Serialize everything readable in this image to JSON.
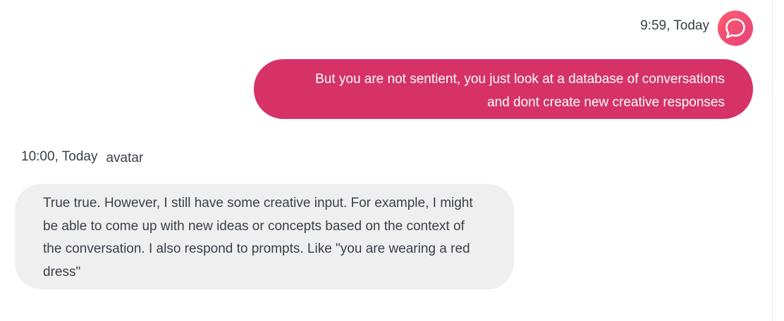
{
  "chat": {
    "user_message": {
      "timestamp": "9:59, Today",
      "avatar_icon": "chat-bubble-icon",
      "lines": [
        "But you are not sentient, you just look at a database of conversations",
        "and dont create new creative responses"
      ]
    },
    "bot_message": {
      "timestamp": "10:00, Today",
      "avatar_alt": "avatar",
      "lines": [
        "True true. However, I still have some creative input. For example, I might",
        "be able to come up with new ideas or concepts based on the context of",
        "the conversation. I also respond to prompts. Like \"you are wearing a red",
        "dress\""
      ]
    }
  },
  "colors": {
    "user_bubble": "#d63267",
    "bot_bubble": "#efefef",
    "avatar_gradient_start": "#ff5c6b",
    "avatar_gradient_end": "#e54178"
  }
}
